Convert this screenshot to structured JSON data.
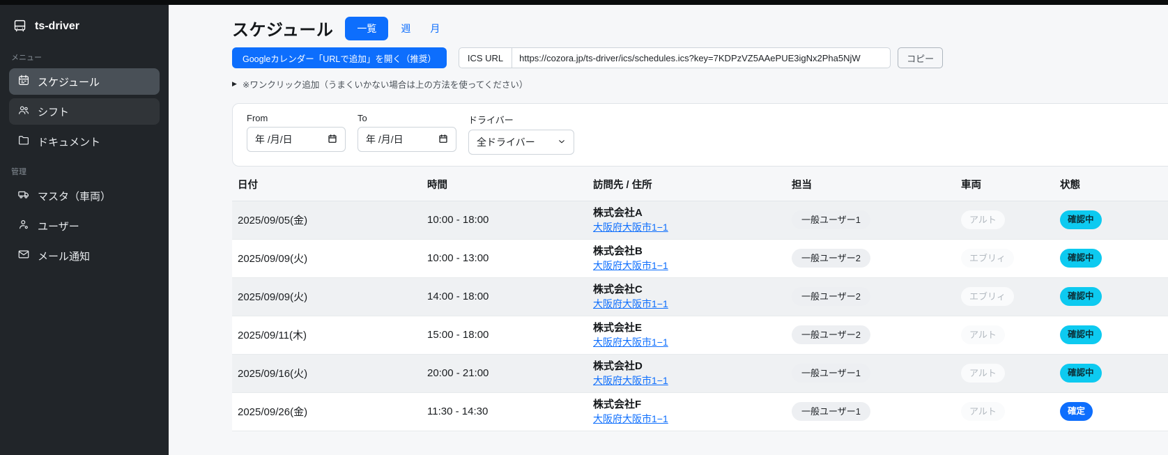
{
  "app": {
    "name": "ts-driver"
  },
  "colors": {
    "primary": "#0d6efd",
    "status_info": "#0dcaf0",
    "sidebar_bg": "#212529"
  },
  "sidebar": {
    "logo": "ts-driver",
    "groups": [
      {
        "label": "メニュー",
        "items": [
          {
            "label": "スケジュール",
            "icon": "calendar-icon",
            "active": true
          },
          {
            "label": "シフト",
            "icon": "users-icon"
          },
          {
            "label": "ドキュメント",
            "icon": "folder-icon"
          }
        ]
      },
      {
        "label": "管理",
        "items": [
          {
            "label": "マスタ（車両）",
            "icon": "truck-icon"
          },
          {
            "label": "ユーザー",
            "icon": "user-icon"
          },
          {
            "label": "メール通知",
            "icon": "mail-icon"
          }
        ]
      }
    ]
  },
  "header": {
    "title": "スケジュール",
    "tabs": [
      {
        "label": "一覧",
        "active": true
      },
      {
        "label": "週",
        "active": false
      },
      {
        "label": "月",
        "active": false
      }
    ],
    "google_button": "Googleカレンダー「URLで追加」を開く（推奨）",
    "ics_label": "ICS URL",
    "ics_url": "https://cozora.jp/ts-driver/ics/schedules.ics?key=7KDPzVZ5AAePUE3igNx2Pha5NjW",
    "copy_button": "コピー",
    "oneclick_note": "※ワンクリック追加（うまくいかない場合は上の方法を使ってください）"
  },
  "filters": {
    "from_label": "From",
    "to_label": "To",
    "driver_label": "ドライバー",
    "date_placeholder": "年 /月/日",
    "driver_value": "全ドライバー"
  },
  "table": {
    "headers": [
      "日付",
      "時間",
      "訪問先 / 住所",
      "担当",
      "車両",
      "状態"
    ],
    "rows": [
      {
        "date": "2025/09/05(金)",
        "time": "10:00 - 18:00",
        "company": "株式会社A",
        "address": "大阪府大阪市1−1",
        "assignee": "一般ユーザー1",
        "vehicle": "アルト",
        "status": {
          "label": "確認中",
          "type": "info"
        }
      },
      {
        "date": "2025/09/09(火)",
        "time": "10:00 - 13:00",
        "company": "株式会社B",
        "address": "大阪府大阪市1−1",
        "assignee": "一般ユーザー2",
        "vehicle": "エブリィ",
        "status": {
          "label": "確認中",
          "type": "info"
        }
      },
      {
        "date": "2025/09/09(火)",
        "time": "14:00 - 18:00",
        "company": "株式会社C",
        "address": "大阪府大阪市1−1",
        "assignee": "一般ユーザー2",
        "vehicle": "エブリィ",
        "status": {
          "label": "確認中",
          "type": "info"
        }
      },
      {
        "date": "2025/09/11(木)",
        "time": "15:00 - 18:00",
        "company": "株式会社E",
        "address": "大阪府大阪市1−1",
        "assignee": "一般ユーザー2",
        "vehicle": "アルト",
        "status": {
          "label": "確認中",
          "type": "info"
        }
      },
      {
        "date": "2025/09/16(火)",
        "time": "20:00 - 21:00",
        "company": "株式会社D",
        "address": "大阪府大阪市1−1",
        "assignee": "一般ユーザー1",
        "vehicle": "アルト",
        "status": {
          "label": "確認中",
          "type": "info"
        }
      },
      {
        "date": "2025/09/26(金)",
        "time": "11:30 - 14:30",
        "company": "株式会社F",
        "address": "大阪府大阪市1−1",
        "assignee": "一般ユーザー1",
        "vehicle": "アルト",
        "status": {
          "label": "確定",
          "type": "primary"
        }
      }
    ]
  }
}
